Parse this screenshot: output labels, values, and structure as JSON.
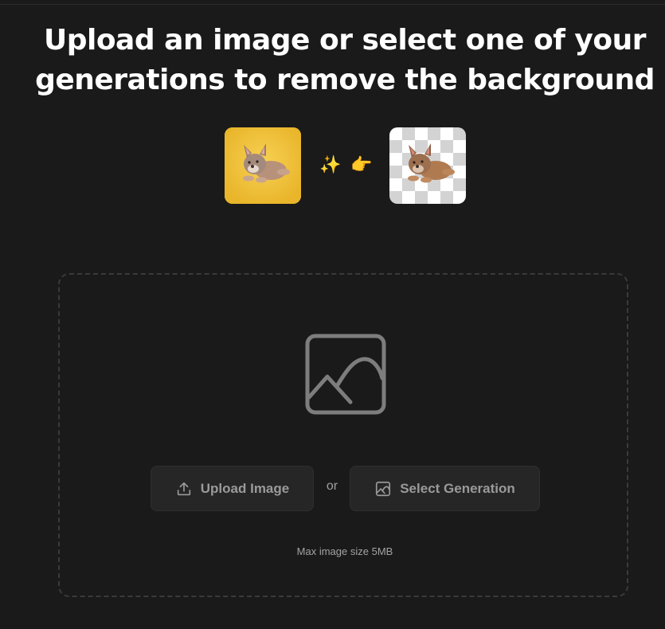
{
  "header": {
    "headline": "Upload an image or select one of your generations to remove the background"
  },
  "example": {
    "before_image_icon": "dog-photo-yellow-background",
    "after_image_icon": "dog-cutout-transparent-background",
    "sparkles_emoji": "✨",
    "pointing_emoji": "👉"
  },
  "dropzone": {
    "placeholder_icon": "image-icon",
    "upload_button": {
      "label": "Upload Image",
      "icon": "upload-icon"
    },
    "or_text": "or",
    "select_button": {
      "label": "Select Generation",
      "icon": "image-icon"
    },
    "max_size_text": "Max image size 5MB"
  },
  "colors": {
    "background": "#1a1a1a",
    "button_bg": "#262626",
    "button_text": "#9a9a9a",
    "headline": "#ffffff",
    "dashed_border": "#3a3a3a",
    "before_bg": "#f1c232"
  }
}
